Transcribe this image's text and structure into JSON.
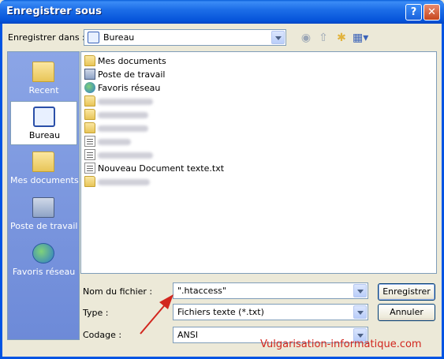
{
  "window": {
    "title": "Enregistrer sous",
    "help_label": "?",
    "close_label": "✕"
  },
  "save_in": {
    "label": "Enregistrer dans :",
    "value": "Bureau"
  },
  "places": [
    {
      "label": "Recent",
      "icon": "recent-folder-icon",
      "selected": false
    },
    {
      "label": "Bureau",
      "icon": "desktop-icon",
      "selected": true
    },
    {
      "label": "Mes documents",
      "icon": "documents-folder-icon",
      "selected": false
    },
    {
      "label": "Poste de travail",
      "icon": "computer-icon",
      "selected": false
    },
    {
      "label": "Favoris réseau",
      "icon": "network-icon",
      "selected": false
    }
  ],
  "files": [
    {
      "name": "Mes documents",
      "icon": "documents-folder-icon",
      "blurred": false
    },
    {
      "name": "Poste de travail",
      "icon": "computer-icon",
      "blurred": false
    },
    {
      "name": "Favoris réseau",
      "icon": "network-icon",
      "blurred": false
    },
    {
      "name": "",
      "icon": "folder-icon",
      "blurred": true
    },
    {
      "name": "",
      "icon": "folder-icon",
      "blurred": true
    },
    {
      "name": "",
      "icon": "folder-icon",
      "blurred": true
    },
    {
      "name": "",
      "icon": "text-file-icon",
      "blurred": true
    },
    {
      "name": "",
      "icon": "text-file-icon",
      "blurred": true
    },
    {
      "name": "Nouveau Document texte.txt",
      "icon": "text-file-icon",
      "blurred": false
    },
    {
      "name": "",
      "icon": "shortcut-folder-icon",
      "blurred": true
    }
  ],
  "filename": {
    "label": "Nom du fichier :",
    "value": "\".htaccess\""
  },
  "filetype": {
    "label": "Type :",
    "value": "Fichiers texte (*.txt)"
  },
  "encoding": {
    "label": "Codage :",
    "value": "ANSI"
  },
  "buttons": {
    "save": "Enregistrer",
    "cancel": "Annuler"
  },
  "watermark": "Vulgarisation-informatique.com",
  "colors": {
    "titlebar": "#0054e3",
    "places_bar": "#7a96df",
    "annotation_arrow": "#d2261e"
  }
}
